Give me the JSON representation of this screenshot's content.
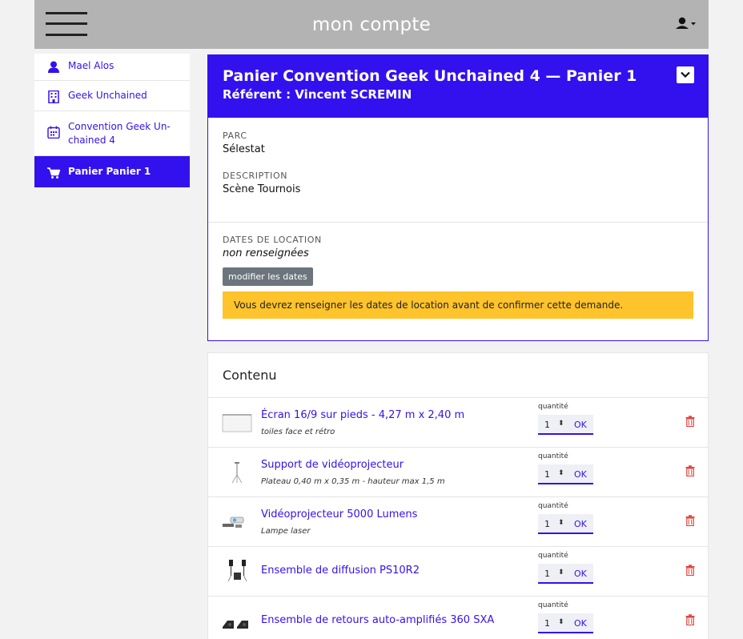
{
  "header": {
    "title": "mon compte"
  },
  "sidebar": {
    "items": [
      {
        "label": "Mael Alos",
        "icon": "user-icon"
      },
      {
        "label": "Geek Unchained",
        "icon": "building-icon"
      },
      {
        "label": "Convention Geek Un-chained 4",
        "icon": "calendar-icon"
      },
      {
        "label": "Panier Panier 1",
        "icon": "cart-icon",
        "active": true
      }
    ]
  },
  "cart": {
    "title": "Panier Convention Geek Unchained 4 — Panier 1",
    "referent": "Référent : Vincent SCREMIN",
    "parc_label": "PARC",
    "parc_value": "Sélestat",
    "description_label": "DESCRIPTION",
    "description_value": "Scène Tournois",
    "dates_label": "DATES DE LOCATION",
    "dates_value": "non renseignées",
    "modify_dates_button": "modifier les dates",
    "warning": "Vous devrez renseigner les dates de location avant de confirmer cette demande."
  },
  "content": {
    "title": "Contenu",
    "quantity_label": "quantité",
    "ok_label": "OK",
    "items": [
      {
        "name": "Écran 16/9 sur pieds - 4,27 m x 2,40 m",
        "desc": "toiles face et rétro",
        "qty": "1"
      },
      {
        "name": "Support de vidéoprojecteur",
        "desc": "Plateau 0,40 m x 0,35 m - hauteur max 1,5 m",
        "qty": "1"
      },
      {
        "name": "Vidéoprojecteur 5000 Lumens",
        "desc": "Lampe laser",
        "qty": "1"
      },
      {
        "name": "Ensemble de diffusion PS10R2",
        "desc": "",
        "qty": "1"
      },
      {
        "name": "Ensemble de retours auto-amplifiés 360 SXA",
        "desc": "",
        "qty": "1"
      }
    ]
  },
  "colors": {
    "accent": "#3311ee",
    "topbar": "#b3b3b3",
    "warning": "#ffc32b",
    "trash": "#e0403a"
  }
}
